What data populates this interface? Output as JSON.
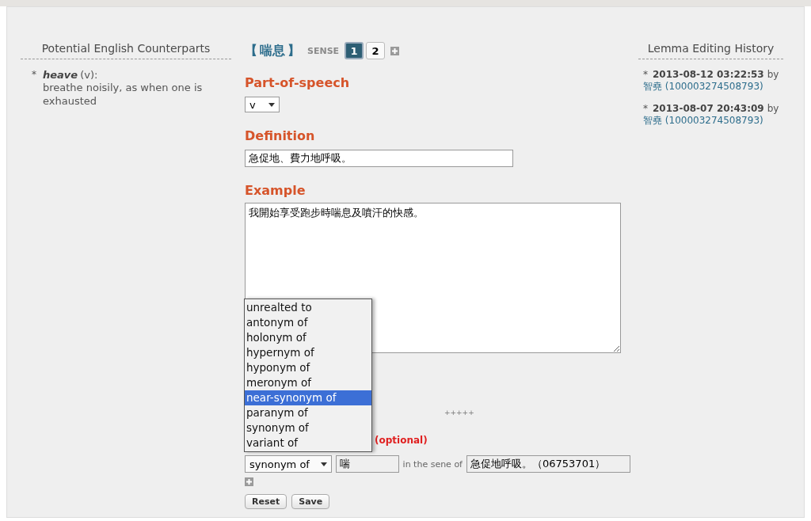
{
  "counterparts": {
    "title": "Potential English Counterparts",
    "items": [
      {
        "bullet": "*",
        "word": "heave",
        "pos": "(v):",
        "gloss": "breathe noisily, as when one is exhausted"
      }
    ]
  },
  "lemma": {
    "open": "【",
    "word": "喘息",
    "close": "】",
    "sense_label": "SENSE",
    "senses": [
      {
        "label": "1",
        "selected": true
      },
      {
        "label": "2",
        "selected": false
      }
    ]
  },
  "part_of_speech": {
    "heading": "Part-of-speech",
    "value": "v"
  },
  "definition": {
    "heading": "Definition",
    "value": "急促地、費力地呼吸。"
  },
  "example": {
    "heading": "Example",
    "value": "我開始享受跑步時喘息及噴汗的快感。"
  },
  "separator": "+++++",
  "relation": {
    "note": "(optional)",
    "value": "synonym of",
    "word": "喘",
    "connector": "in the sene of",
    "sense": "急促地呼吸。（06753701）"
  },
  "relation_options": [
    {
      "label": "unrealted to",
      "selected": false
    },
    {
      "label": "antonym of",
      "selected": false
    },
    {
      "label": "holonym of",
      "selected": false
    },
    {
      "label": "hypernym of",
      "selected": false
    },
    {
      "label": "hyponym of",
      "selected": false
    },
    {
      "label": "meronym of",
      "selected": false
    },
    {
      "label": "near-synonym of",
      "selected": true
    },
    {
      "label": "paranym of",
      "selected": false
    },
    {
      "label": "synonym of",
      "selected": false
    },
    {
      "label": "variant of",
      "selected": false
    }
  ],
  "buttons": [
    "Reset",
    "Save"
  ],
  "history": {
    "title": "Lemma Editing History",
    "entries": [
      {
        "bullet": "*",
        "time": "2013-08-12 03:22:53",
        "by": "by",
        "user": "智堯 (100003274508793)"
      },
      {
        "bullet": "*",
        "time": "2013-08-07 20:43:09",
        "by": "by",
        "user": "智堯 (100003274508793)"
      }
    ]
  }
}
